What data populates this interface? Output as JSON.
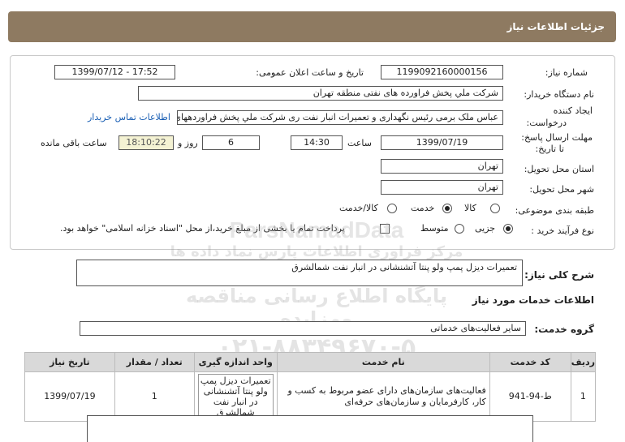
{
  "header": {
    "title": "جزئیات اطلاعات نیاز"
  },
  "form": {
    "need_number_label": "شماره نیاز:",
    "need_number": "1199092160000156",
    "announce_label": "تاریخ و ساعت اعلان عمومی:",
    "announce_value": "1399/07/12 - 17:52",
    "buyer_label": "نام دستگاه خریدار:",
    "buyer_value": "شرکت ملي پخش فراورده های نفتی منطقه تهران",
    "creator_label_1": "ایجاد کننده",
    "creator_label_2": "درخواست:",
    "creator_value": "عباس ملک برمی رئیس نگهداری و تعمیرات انبار نفت ری شرکت ملي پخش فراوردههای",
    "contact_link": "اطلاعات تماس خریدار",
    "deadline_label_1": "مهلت ارسال پاسخ:",
    "deadline_label_2": "تا تاریخ:",
    "deadline_date": "1399/07/19",
    "time_label": "ساعت",
    "deadline_time": "14:30",
    "days_value": "6",
    "days_label": "روز و",
    "remaining_time": "18:10:22",
    "remaining_label": "ساعت باقی مانده",
    "province_label": "استان محل تحویل:",
    "province_value": "تهران",
    "city_label": "شهر محل تحویل:",
    "city_value": "تهران",
    "category_label": "طبقه بندی موضوعی:",
    "category_options": [
      "کالا",
      "خدمت",
      "کالا/خدمت"
    ],
    "category_selected": "خدمت",
    "process_label": "نوع فرآیند خرید :",
    "process_options": [
      "جزیی",
      "متوسط"
    ],
    "process_selected": "جزیی",
    "payment_note": "پرداخت تمام یا بخشی از مبلغ خرید،از محل \"اسناد خزانه اسلامی\" خواهد بود."
  },
  "description": {
    "label": "شرح کلی نیاز:",
    "value": "تعمیرات دیزل پمپ ولو پنتا آتشنشانی در انبار نفت شمالشرق"
  },
  "services": {
    "section_title": "اطلاعات خدمات مورد نیاز",
    "group_label": "گروه خدمت:",
    "group_value": "سایر فعالیت‌های خدماتی",
    "columns": [
      "ردیف",
      "کد خدمت",
      "نام خدمت",
      "واحد اندازه گیری",
      "تعداد / مقدار",
      "تاریخ نیاز"
    ],
    "rows": [
      {
        "index": "1",
        "code": "ط-94-941",
        "name": "فعالیت‌های سازمان‌های دارای عضو مربوط به کسب و کار، کارفرمایان و سازمان‌های حرفه‌ای",
        "unit": "تعمیرات دیزل پمپ ولو پنتا آتشنشانی در انبار نفت شمالشرق",
        "quantity": "1",
        "date": "1399/07/19"
      }
    ]
  },
  "watermark": {
    "line1": "ParsNamadData",
    "line2": "مرکز فراوری اطلاعات پارس نماد داده ها",
    "line3": "پایگاه اطلاع رسانی مناقصه ومزایده",
    "line4": "۰۲۱-۸۸۳۴۹۶۷۰-۵"
  },
  "colors": {
    "header_bg": "#8e7a61",
    "link": "#1a5fb4",
    "remaining_bg": "#f4f2d3"
  }
}
